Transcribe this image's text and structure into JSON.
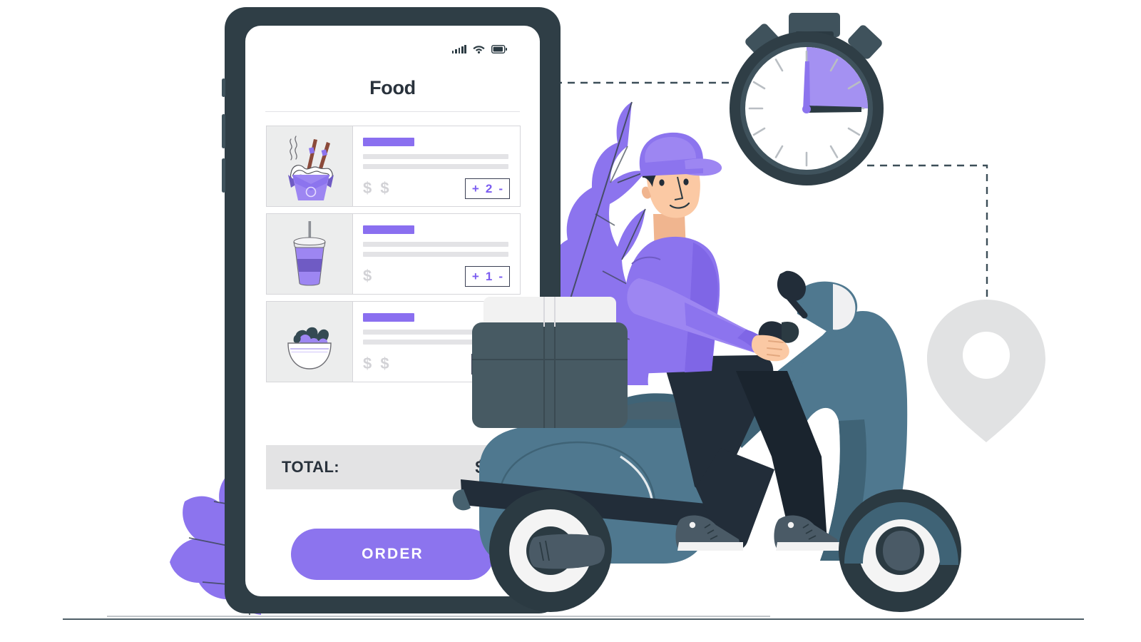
{
  "scene": {
    "title": "Food delivery illustration",
    "background": "#ffffff",
    "ground_line_color": "#3c4e58"
  },
  "colors": {
    "purple": "#8c74ee",
    "purple_light": "#a491f2",
    "purple_deep": "#6f5bc4",
    "dark": "#2b3a42",
    "dark_navy": "#222d39",
    "scooter_blue": "#4f788f",
    "scooter_blue_dark": "#3f6376",
    "skin": "#fbc9a4",
    "grey_light": "#e3e3e4",
    "grey_mid": "#d2d2d6",
    "white": "#ffffff"
  },
  "phone": {
    "frame_color": "#2f3e46",
    "status_bar": {
      "signal_icon": "cellular-signal-icon",
      "wifi_icon": "wifi-icon",
      "battery_icon": "battery-icon",
      "bars": 5
    },
    "screen": {
      "title": "Food",
      "items": [
        {
          "thumb_icon": "noodle-box-icon",
          "name_placeholder": "",
          "price": "$ $",
          "quantity": "2",
          "plus_label": "+",
          "minus_label": "-"
        },
        {
          "thumb_icon": "drink-cup-icon",
          "name_placeholder": "",
          "price": "$",
          "quantity": "1",
          "plus_label": "+",
          "minus_label": "-"
        },
        {
          "thumb_icon": "salad-bowl-icon",
          "name_placeholder": "",
          "price": "$ $",
          "quantity": "",
          "plus_label": "+",
          "minus_label": "-"
        }
      ],
      "total": {
        "label": "TOTAL:",
        "value": "$$$"
      },
      "order_button": {
        "label": "ORDER"
      }
    }
  },
  "stopwatch": {
    "name": "stopwatch-icon",
    "body_color": "#2f3e46",
    "face_color": "#ffffff",
    "arc_color": "#a491f2",
    "arc_from_hour": 12,
    "arc_to_hour": 3,
    "minute_hand_points_to": 12,
    "hour_hand_points_to": 3,
    "tick_count": 12
  },
  "location_pin": {
    "name": "map-pin-icon",
    "fill": "#e1e2e3"
  },
  "route": {
    "name": "dashed-route",
    "color": "#3c4e58",
    "dash": "10 8"
  },
  "rider": {
    "name": "delivery-rider",
    "cap_color": "#8c74ee",
    "shirt_color": "#8c74ee",
    "pants_color": "#222d39",
    "shoe_color": "#4a5a66",
    "skin_color": "#fbc9a4",
    "hair_color": "#222d39"
  },
  "scooter": {
    "name": "delivery-scooter",
    "body_color": "#4f788f",
    "accent_color": "#3f6376",
    "wheel_color": "#2b3a42",
    "wheel_inner_color": "#f4f4f4",
    "delivery_box_color": "#475a63",
    "delivery_box_lid_color": "#f2f2f2"
  },
  "plants": [
    {
      "name": "leaf-right",
      "color": "#8c74ee"
    },
    {
      "name": "leaf-left",
      "color": "#8c74ee"
    }
  ]
}
